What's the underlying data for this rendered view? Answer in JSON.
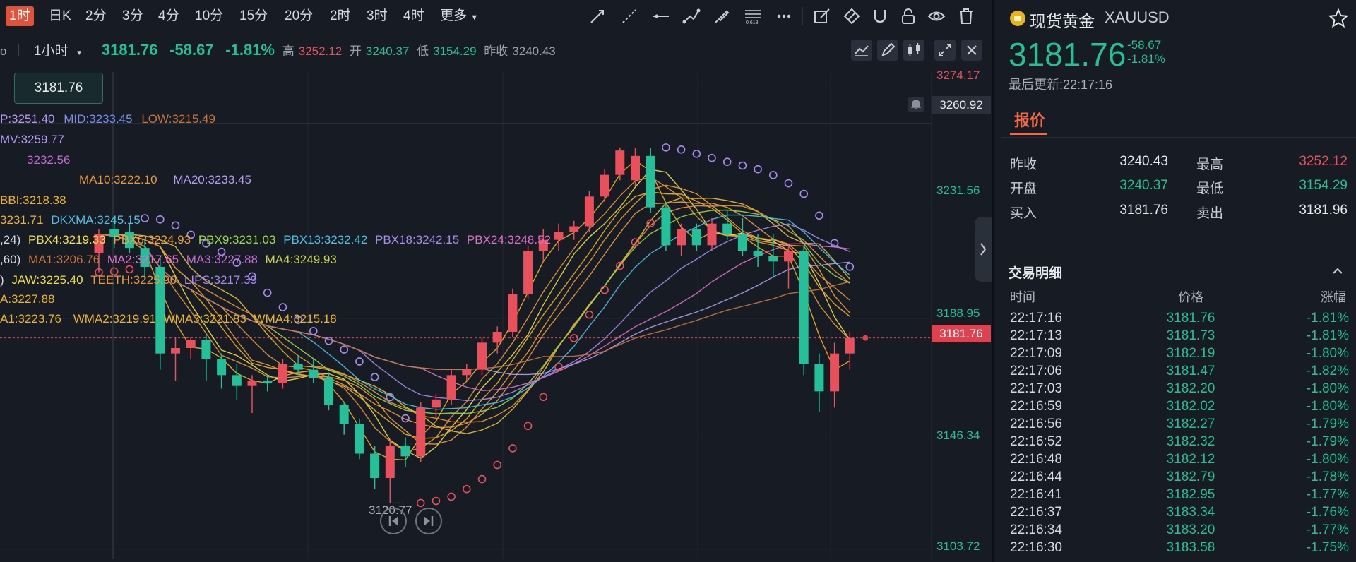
{
  "toolbar": {
    "timeframes": [
      "1时",
      "日K",
      "2分",
      "3分",
      "4分",
      "10分",
      "15分",
      "20分",
      "2时",
      "3时",
      "4时",
      "更多"
    ],
    "active_timeframe": "1时",
    "tools": [
      "trend-line-icon",
      "ray-line-icon",
      "horizontal-line-icon",
      "polyline-icon",
      "brush-icon",
      "fibonacci-icon",
      "more-tools-icon",
      "edit-icon",
      "eraser-icon",
      "magnet-icon",
      "lock-icon",
      "eye-icon",
      "trash-icon"
    ],
    "fib_label": "0.618"
  },
  "chart_header": {
    "interval": "1小时",
    "price": "3181.76",
    "change": "-58.67",
    "change_pct": "-1.81%",
    "high_label": "高",
    "high": "3252.12",
    "open_label": "开",
    "open": "3240.37",
    "low_label": "低",
    "low": "3154.29",
    "prev_label": "昨收",
    "prev": "3240.43"
  },
  "cursor_price": "3181.76",
  "indicators": {
    "line1": [
      {
        "text": "P:3251.40",
        "color": "#b69cf0"
      },
      {
        "text": "MID:3233.45",
        "color": "#7a8ef0"
      },
      {
        "text": "LOW:3215.49",
        "color": "#c8743d"
      }
    ],
    "line2": [
      {
        "text": "MV:3259.77",
        "color": "#b69cf0"
      }
    ],
    "line3": [
      {
        "text": "3232.56",
        "color": "#c46bd4"
      }
    ],
    "line4": [
      {
        "text": "MA10:3222.10",
        "color": "#e89a3a"
      },
      {
        "text": "MA20:3233.45",
        "color": "#b69cf0"
      }
    ],
    "line5": [
      {
        "text": "BBI:3218.38",
        "color": "#f0b429"
      }
    ],
    "line6": [
      {
        "text": "3231.71",
        "color": "#f0b429"
      },
      {
        "text": "DKXMA:3245.15",
        "color": "#4cc4e6"
      }
    ],
    "line7": [
      {
        "text": ",24)",
        "color": "#d5d9e0"
      },
      {
        "text": "PBX4:3219.33",
        "color": "#f0e04a"
      },
      {
        "text": "PBX6:3224.93",
        "color": "#f0a03a"
      },
      {
        "text": "PBX9:3231.03",
        "color": "#9ad84a"
      },
      {
        "text": "PBX13:3232.42",
        "color": "#4cc4e6"
      },
      {
        "text": "PBX18:3242.15",
        "color": "#a88cf0"
      },
      {
        "text": "PBX24:3248.52",
        "color": "#e070c8"
      }
    ],
    "line8": [
      {
        "text": ",60)",
        "color": "#d5d9e0"
      },
      {
        "text": "MA1:3206.76",
        "color": "#c8743d"
      },
      {
        "text": "MA2:3217.65",
        "color": "#e070c8"
      },
      {
        "text": "MA3:3227.88",
        "color": "#c46bd4"
      },
      {
        "text": "MA4:3249.93",
        "color": "#c8d44a"
      }
    ],
    "line9": [
      {
        "text": ")",
        "color": "#d5d9e0"
      },
      {
        "text": "JAW:3225.40",
        "color": "#f0e04a"
      },
      {
        "text": "TEETH:3225.90",
        "color": "#e89a3a"
      },
      {
        "text": "LIPS:3217.39",
        "color": "#a88cf0"
      }
    ],
    "line10": [
      {
        "text": "A:3227.88",
        "color": "#f0b429"
      }
    ],
    "line11": [
      {
        "text": "A1:3223.76",
        "color": "#f0b429"
      },
      {
        "text": "WMA2:3219.91",
        "color": "#f0b429"
      },
      {
        "text": "WMA3:3221.83",
        "color": "#f0b429"
      },
      {
        "text": "WMA4:3215.18",
        "color": "#f0b429"
      }
    ]
  },
  "price_axis": {
    "top_red": "3274.17",
    "alert_price": "3260.92",
    "labels": [
      "3231.56",
      "3188.95",
      "3146.34",
      "3103.72"
    ],
    "current": "3181.76"
  },
  "low_marker": "3120.77",
  "colors": {
    "up": "#e9505c",
    "down": "#23c09a",
    "accent": "#ef6a45",
    "background": "#161b24"
  },
  "chart_data": {
    "type": "candlestick",
    "ylim": [
      3100,
      3280
    ],
    "current_price": 3181.76,
    "labeled_low": 3120.77,
    "candles": [
      {
        "o": 3213,
        "h": 3222,
        "l": 3206,
        "c": 3220
      },
      {
        "o": 3222,
        "h": 3226,
        "l": 3215,
        "c": 3219
      },
      {
        "o": 3221,
        "h": 3224,
        "l": 3213,
        "c": 3215
      },
      {
        "o": 3215,
        "h": 3218,
        "l": 3203,
        "c": 3208
      },
      {
        "o": 3208,
        "h": 3212,
        "l": 3170,
        "c": 3176
      },
      {
        "o": 3176,
        "h": 3182,
        "l": 3166,
        "c": 3178
      },
      {
        "o": 3178,
        "h": 3182,
        "l": 3174,
        "c": 3181
      },
      {
        "o": 3181,
        "h": 3183,
        "l": 3166,
        "c": 3174
      },
      {
        "o": 3174,
        "h": 3176,
        "l": 3163,
        "c": 3168
      },
      {
        "o": 3168,
        "h": 3172,
        "l": 3159,
        "c": 3164
      },
      {
        "o": 3164,
        "h": 3168,
        "l": 3154,
        "c": 3166
      },
      {
        "o": 3166,
        "h": 3168,
        "l": 3162,
        "c": 3165
      },
      {
        "o": 3165,
        "h": 3174,
        "l": 3163,
        "c": 3172
      },
      {
        "o": 3172,
        "h": 3175,
        "l": 3168,
        "c": 3170
      },
      {
        "o": 3170,
        "h": 3174,
        "l": 3165,
        "c": 3167
      },
      {
        "o": 3167,
        "h": 3169,
        "l": 3155,
        "c": 3157
      },
      {
        "o": 3157,
        "h": 3158,
        "l": 3146,
        "c": 3150
      },
      {
        "o": 3150,
        "h": 3152,
        "l": 3137,
        "c": 3139
      },
      {
        "o": 3139,
        "h": 3142,
        "l": 3126,
        "c": 3130
      },
      {
        "o": 3130,
        "h": 3144,
        "l": 3120.77,
        "c": 3142
      },
      {
        "o": 3142,
        "h": 3145,
        "l": 3134,
        "c": 3138
      },
      {
        "o": 3138,
        "h": 3158,
        "l": 3136,
        "c": 3156
      },
      {
        "o": 3156,
        "h": 3161,
        "l": 3152,
        "c": 3159
      },
      {
        "o": 3159,
        "h": 3170,
        "l": 3157,
        "c": 3168
      },
      {
        "o": 3168,
        "h": 3172,
        "l": 3166,
        "c": 3170
      },
      {
        "o": 3170,
        "h": 3182,
        "l": 3168,
        "c": 3180
      },
      {
        "o": 3180,
        "h": 3186,
        "l": 3176,
        "c": 3184
      },
      {
        "o": 3184,
        "h": 3200,
        "l": 3182,
        "c": 3198
      },
      {
        "o": 3198,
        "h": 3216,
        "l": 3196,
        "c": 3214
      },
      {
        "o": 3214,
        "h": 3222,
        "l": 3210,
        "c": 3218
      },
      {
        "o": 3218,
        "h": 3224,
        "l": 3214,
        "c": 3221
      },
      {
        "o": 3221,
        "h": 3225,
        "l": 3218,
        "c": 3223
      },
      {
        "o": 3223,
        "h": 3236,
        "l": 3221,
        "c": 3234
      },
      {
        "o": 3234,
        "h": 3244,
        "l": 3232,
        "c": 3242
      },
      {
        "o": 3242,
        "h": 3252.12,
        "l": 3240,
        "c": 3251
      },
      {
        "o": 3240,
        "h": 3252,
        "l": 3238,
        "c": 3249
      },
      {
        "o": 3249,
        "h": 3252,
        "l": 3228,
        "c": 3230
      },
      {
        "o": 3230,
        "h": 3232,
        "l": 3214,
        "c": 3216
      },
      {
        "o": 3216,
        "h": 3224,
        "l": 3212,
        "c": 3222
      },
      {
        "o": 3222,
        "h": 3224,
        "l": 3214,
        "c": 3216
      },
      {
        "o": 3216,
        "h": 3226,
        "l": 3214,
        "c": 3224
      },
      {
        "o": 3224,
        "h": 3229,
        "l": 3218,
        "c": 3220
      },
      {
        "o": 3220,
        "h": 3226,
        "l": 3212,
        "c": 3214
      },
      {
        "o": 3214,
        "h": 3220,
        "l": 3208,
        "c": 3212
      },
      {
        "o": 3212,
        "h": 3220,
        "l": 3204,
        "c": 3210
      },
      {
        "o": 3210,
        "h": 3216,
        "l": 3200,
        "c": 3214
      },
      {
        "o": 3214,
        "h": 3216,
        "l": 3168,
        "c": 3172
      },
      {
        "o": 3172,
        "h": 3176,
        "l": 3154.29,
        "c": 3162
      },
      {
        "o": 3162,
        "h": 3180,
        "l": 3156,
        "c": 3176
      },
      {
        "o": 3176,
        "h": 3184,
        "l": 3170,
        "c": 3181.76
      }
    ]
  },
  "panel": {
    "symbol_name": "现货黄金",
    "symbol_code": "XAUUSD",
    "price": "3181.76",
    "change": "-58.67",
    "change_pct": "-1.81%",
    "updated": "最后更新:22:17:16",
    "tab": "报价",
    "quote": [
      {
        "label": "昨收",
        "value": "3240.43",
        "color": "#e6e9ee"
      },
      {
        "label": "开盘",
        "value": "3240.37",
        "color": "#23c09a"
      },
      {
        "label": "买入",
        "value": "3181.76",
        "color": "#e6e9ee"
      },
      {
        "label": "最高",
        "value": "3252.12",
        "color": "#e9505c"
      },
      {
        "label": "最低",
        "value": "3154.29",
        "color": "#23c09a"
      },
      {
        "label": "卖出",
        "value": "3181.96",
        "color": "#e6e9ee"
      }
    ],
    "trades_title": "交易明细",
    "trades_headers": [
      "时间",
      "价格",
      "涨幅"
    ],
    "trades": [
      {
        "time": "22:17:16",
        "price": "3181.76",
        "pct": "-1.81%"
      },
      {
        "time": "22:17:13",
        "price": "3181.73",
        "pct": "-1.81%"
      },
      {
        "time": "22:17:09",
        "price": "3182.19",
        "pct": "-1.80%"
      },
      {
        "time": "22:17:06",
        "price": "3181.47",
        "pct": "-1.82%"
      },
      {
        "time": "22:17:03",
        "price": "3182.20",
        "pct": "-1.80%"
      },
      {
        "time": "22:16:59",
        "price": "3182.02",
        "pct": "-1.80%"
      },
      {
        "time": "22:16:56",
        "price": "3182.27",
        "pct": "-1.79%"
      },
      {
        "time": "22:16:52",
        "price": "3182.32",
        "pct": "-1.79%"
      },
      {
        "time": "22:16:48",
        "price": "3182.12",
        "pct": "-1.80%"
      },
      {
        "time": "22:16:44",
        "price": "3182.79",
        "pct": "-1.78%"
      },
      {
        "time": "22:16:41",
        "price": "3182.95",
        "pct": "-1.77%"
      },
      {
        "time": "22:16:37",
        "price": "3183.34",
        "pct": "-1.76%"
      },
      {
        "time": "22:16:34",
        "price": "3183.20",
        "pct": "-1.77%"
      },
      {
        "time": "22:16:30",
        "price": "3183.58",
        "pct": "-1.75%"
      }
    ]
  }
}
